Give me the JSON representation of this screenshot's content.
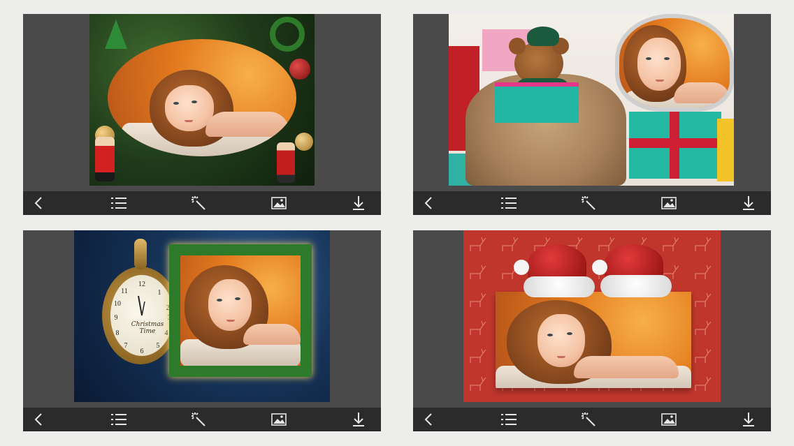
{
  "panels": [
    {
      "id": "christmas-tree-oval-frame"
    },
    {
      "id": "teddy-bear-gifts-frame"
    },
    {
      "id": "pocket-watch-garland-frame"
    },
    {
      "id": "santa-hats-frame"
    }
  ],
  "clock": {
    "text_line1": "Christmas",
    "text_line2": "Time"
  },
  "toolbar": {
    "icons": [
      "back-icon",
      "list-icon",
      "magic-wand-icon",
      "image-icon",
      "download-icon"
    ]
  },
  "colors": {
    "panel_bg": "#4a4a4a",
    "toolbar_bg": "#2b2b2b",
    "page_bg": "#ededeb",
    "accent_red": "#c0362c"
  }
}
